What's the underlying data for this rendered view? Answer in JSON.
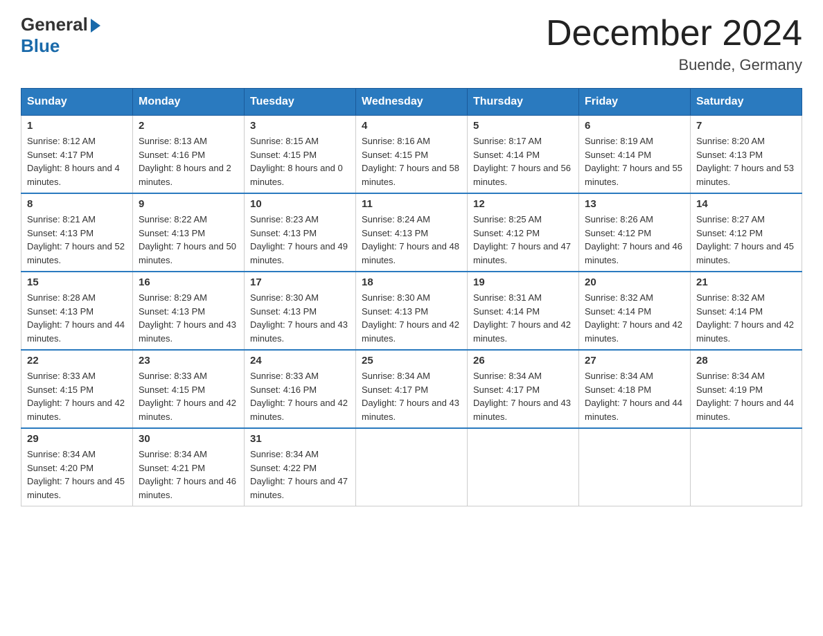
{
  "logo": {
    "general": "General",
    "blue": "Blue"
  },
  "title": "December 2024",
  "location": "Buende, Germany",
  "days_header": [
    "Sunday",
    "Monday",
    "Tuesday",
    "Wednesday",
    "Thursday",
    "Friday",
    "Saturday"
  ],
  "weeks": [
    [
      {
        "day": "1",
        "sunrise": "8:12 AM",
        "sunset": "4:17 PM",
        "daylight": "8 hours and 4 minutes."
      },
      {
        "day": "2",
        "sunrise": "8:13 AM",
        "sunset": "4:16 PM",
        "daylight": "8 hours and 2 minutes."
      },
      {
        "day": "3",
        "sunrise": "8:15 AM",
        "sunset": "4:15 PM",
        "daylight": "8 hours and 0 minutes."
      },
      {
        "day": "4",
        "sunrise": "8:16 AM",
        "sunset": "4:15 PM",
        "daylight": "7 hours and 58 minutes."
      },
      {
        "day": "5",
        "sunrise": "8:17 AM",
        "sunset": "4:14 PM",
        "daylight": "7 hours and 56 minutes."
      },
      {
        "day": "6",
        "sunrise": "8:19 AM",
        "sunset": "4:14 PM",
        "daylight": "7 hours and 55 minutes."
      },
      {
        "day": "7",
        "sunrise": "8:20 AM",
        "sunset": "4:13 PM",
        "daylight": "7 hours and 53 minutes."
      }
    ],
    [
      {
        "day": "8",
        "sunrise": "8:21 AM",
        "sunset": "4:13 PM",
        "daylight": "7 hours and 52 minutes."
      },
      {
        "day": "9",
        "sunrise": "8:22 AM",
        "sunset": "4:13 PM",
        "daylight": "7 hours and 50 minutes."
      },
      {
        "day": "10",
        "sunrise": "8:23 AM",
        "sunset": "4:13 PM",
        "daylight": "7 hours and 49 minutes."
      },
      {
        "day": "11",
        "sunrise": "8:24 AM",
        "sunset": "4:13 PM",
        "daylight": "7 hours and 48 minutes."
      },
      {
        "day": "12",
        "sunrise": "8:25 AM",
        "sunset": "4:12 PM",
        "daylight": "7 hours and 47 minutes."
      },
      {
        "day": "13",
        "sunrise": "8:26 AM",
        "sunset": "4:12 PM",
        "daylight": "7 hours and 46 minutes."
      },
      {
        "day": "14",
        "sunrise": "8:27 AM",
        "sunset": "4:12 PM",
        "daylight": "7 hours and 45 minutes."
      }
    ],
    [
      {
        "day": "15",
        "sunrise": "8:28 AM",
        "sunset": "4:13 PM",
        "daylight": "7 hours and 44 minutes."
      },
      {
        "day": "16",
        "sunrise": "8:29 AM",
        "sunset": "4:13 PM",
        "daylight": "7 hours and 43 minutes."
      },
      {
        "day": "17",
        "sunrise": "8:30 AM",
        "sunset": "4:13 PM",
        "daylight": "7 hours and 43 minutes."
      },
      {
        "day": "18",
        "sunrise": "8:30 AM",
        "sunset": "4:13 PM",
        "daylight": "7 hours and 42 minutes."
      },
      {
        "day": "19",
        "sunrise": "8:31 AM",
        "sunset": "4:14 PM",
        "daylight": "7 hours and 42 minutes."
      },
      {
        "day": "20",
        "sunrise": "8:32 AM",
        "sunset": "4:14 PM",
        "daylight": "7 hours and 42 minutes."
      },
      {
        "day": "21",
        "sunrise": "8:32 AM",
        "sunset": "4:14 PM",
        "daylight": "7 hours and 42 minutes."
      }
    ],
    [
      {
        "day": "22",
        "sunrise": "8:33 AM",
        "sunset": "4:15 PM",
        "daylight": "7 hours and 42 minutes."
      },
      {
        "day": "23",
        "sunrise": "8:33 AM",
        "sunset": "4:15 PM",
        "daylight": "7 hours and 42 minutes."
      },
      {
        "day": "24",
        "sunrise": "8:33 AM",
        "sunset": "4:16 PM",
        "daylight": "7 hours and 42 minutes."
      },
      {
        "day": "25",
        "sunrise": "8:34 AM",
        "sunset": "4:17 PM",
        "daylight": "7 hours and 43 minutes."
      },
      {
        "day": "26",
        "sunrise": "8:34 AM",
        "sunset": "4:17 PM",
        "daylight": "7 hours and 43 minutes."
      },
      {
        "day": "27",
        "sunrise": "8:34 AM",
        "sunset": "4:18 PM",
        "daylight": "7 hours and 44 minutes."
      },
      {
        "day": "28",
        "sunrise": "8:34 AM",
        "sunset": "4:19 PM",
        "daylight": "7 hours and 44 minutes."
      }
    ],
    [
      {
        "day": "29",
        "sunrise": "8:34 AM",
        "sunset": "4:20 PM",
        "daylight": "7 hours and 45 minutes."
      },
      {
        "day": "30",
        "sunrise": "8:34 AM",
        "sunset": "4:21 PM",
        "daylight": "7 hours and 46 minutes."
      },
      {
        "day": "31",
        "sunrise": "8:34 AM",
        "sunset": "4:22 PM",
        "daylight": "7 hours and 47 minutes."
      },
      null,
      null,
      null,
      null
    ]
  ],
  "labels": {
    "sunrise": "Sunrise:",
    "sunset": "Sunset:",
    "daylight": "Daylight:"
  }
}
